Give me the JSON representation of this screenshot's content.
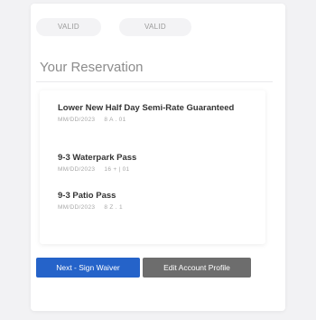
{
  "filters": {
    "left_label": "VALID",
    "right_label": "VALID"
  },
  "reservation": {
    "title": "Your Reservation",
    "items": [
      {
        "name": "Lower New Half Day Semi-Rate Guaranteed",
        "date": "MM/DD/2023",
        "code": "8 A . 01"
      },
      {
        "name": "9-3 Waterpark Pass",
        "date": "MM/DD/2023",
        "code": "16 + | 01"
      },
      {
        "name": "9-3 Patio Pass",
        "date": "MM/DD/2023",
        "code": "8 Z . 1"
      }
    ]
  },
  "actions": {
    "next_label": "Next - Sign Waiver",
    "edit_label": "Edit Account Profile"
  },
  "colors": {
    "primary": "#2563c9",
    "secondary": "#6d6d6d"
  }
}
